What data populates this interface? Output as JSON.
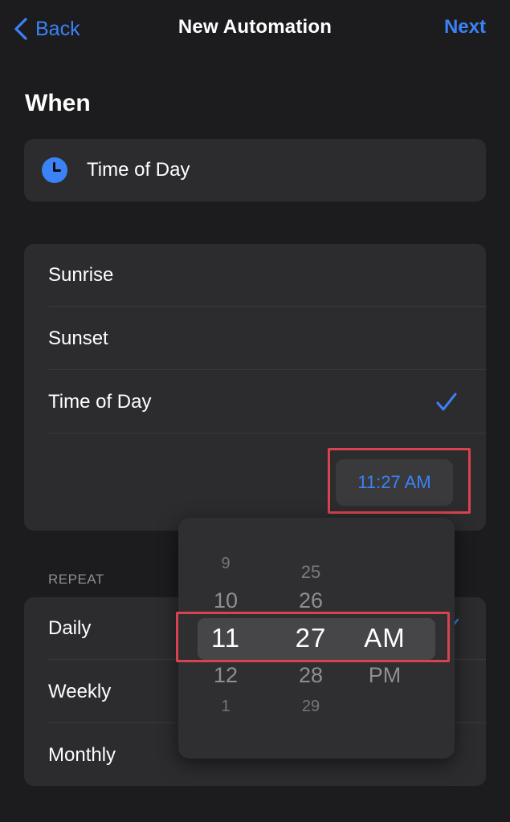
{
  "nav": {
    "back_label": "Back",
    "title": "New Automation",
    "next_label": "Next"
  },
  "when": {
    "heading": "When",
    "trigger_label": "Time of Day"
  },
  "options": {
    "sunrise": "Sunrise",
    "sunset": "Sunset",
    "time_of_day": "Time of Day",
    "selected": "Time of Day",
    "time_value": "11:27 AM"
  },
  "repeat": {
    "header": "REPEAT",
    "daily": "Daily",
    "weekly": "Weekly",
    "monthly": "Monthly"
  },
  "picker": {
    "hours": [
      "9",
      "10",
      "11",
      "12",
      "1"
    ],
    "minutes": [
      "25",
      "26",
      "27",
      "28",
      "29"
    ],
    "periods": [
      "AM",
      "PM"
    ],
    "selected_hour": "11",
    "selected_minute": "27",
    "selected_period": "AM"
  },
  "colors": {
    "accent": "#3b82f6",
    "highlight": "#d9434f",
    "background": "#1c1c1e",
    "card": "#2c2c2e"
  }
}
